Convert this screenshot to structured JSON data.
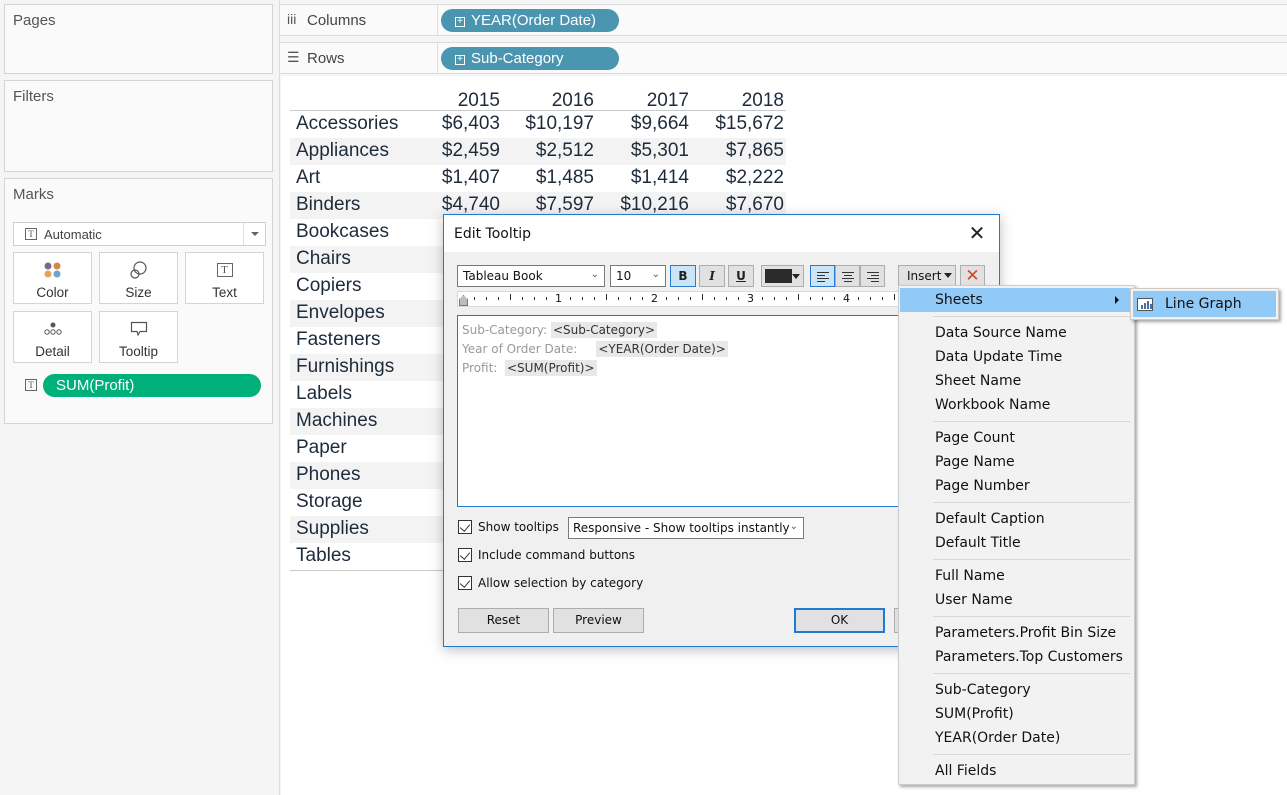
{
  "panels": {
    "pages_title": "Pages",
    "filters_title": "Filters",
    "marks_title": "Marks"
  },
  "marks": {
    "type_selected": "Automatic",
    "buttons": [
      {
        "label": "Color",
        "icon": "color-icon"
      },
      {
        "label": "Size",
        "icon": "size-icon"
      },
      {
        "label": "Text",
        "icon": "text-icon"
      },
      {
        "label": "Detail",
        "icon": "detail-icon"
      },
      {
        "label": "Tooltip",
        "icon": "tooltip-icon"
      }
    ],
    "field_pill": "SUM(Profit)",
    "field_pill_color": "#00b07a",
    "text_icon_glyph": "T"
  },
  "shelves": {
    "columns_label": "Columns",
    "columns_icon": "iii",
    "columns_pill": "YEAR(Order Date)",
    "rows_label": "Rows",
    "rows_icon": "☰",
    "rows_pill": "Sub-Category",
    "pill_color": "#4a96b0",
    "pill_plus": "+"
  },
  "table": {
    "years": [
      "2015",
      "2016",
      "2017",
      "2018"
    ],
    "rows": [
      {
        "label": "Accessories",
        "values": [
          "$6,403",
          "$10,197",
          "$9,664",
          "$15,672"
        ]
      },
      {
        "label": "Appliances",
        "values": [
          "$2,459",
          "$2,512",
          "$5,301",
          "$7,865"
        ]
      },
      {
        "label": "Art",
        "values": [
          "$1,407",
          "$1,485",
          "$1,414",
          "$2,222"
        ]
      },
      {
        "label": "Binders",
        "values": [
          "$4,740",
          "$7,597",
          "$10,216",
          "$7,670"
        ]
      },
      {
        "label": "Bookcases",
        "values": [
          "",
          "",
          "",
          ""
        ]
      },
      {
        "label": "Chairs",
        "values": [
          "",
          "",
          "",
          ""
        ]
      },
      {
        "label": "Copiers",
        "values": [
          "",
          "",
          "",
          ""
        ]
      },
      {
        "label": "Envelopes",
        "values": [
          "",
          "",
          "",
          ""
        ]
      },
      {
        "label": "Fasteners",
        "values": [
          "",
          "",
          "",
          ""
        ]
      },
      {
        "label": "Furnishings",
        "values": [
          "",
          "",
          "",
          ""
        ]
      },
      {
        "label": "Labels",
        "values": [
          "",
          "",
          "",
          ""
        ]
      },
      {
        "label": "Machines",
        "values": [
          "",
          "",
          "",
          ""
        ]
      },
      {
        "label": "Paper",
        "values": [
          "",
          "",
          "",
          ""
        ]
      },
      {
        "label": "Phones",
        "values": [
          "$",
          "",
          "",
          ""
        ]
      },
      {
        "label": "Storage",
        "values": [
          "",
          "",
          "",
          ""
        ]
      },
      {
        "label": "Supplies",
        "values": [
          "",
          "",
          "",
          ""
        ]
      },
      {
        "label": "Tables",
        "values": [
          "–",
          "",
          "",
          ""
        ]
      }
    ]
  },
  "dialog": {
    "title": "Edit Tooltip",
    "close_glyph": "✕",
    "font": "Tableau Book",
    "font_size": "10",
    "bold": "B",
    "italic": "I",
    "underline": "U",
    "insert_label": "Insert",
    "clear_glyph": "✕",
    "ruler_numbers": [
      "1",
      "2",
      "3",
      "4"
    ],
    "editor_lines": [
      {
        "label": "Sub-Category: ",
        "field": "<Sub-Category>"
      },
      {
        "label": "Year of Order Date:     ",
        "field": "<YEAR(Order Date)>"
      },
      {
        "label": "Profit:  ",
        "field": "<SUM(Profit)>"
      }
    ],
    "show_tooltips_label": "Show tooltips",
    "show_tooltips_checked": true,
    "tooltip_mode": "Responsive - Show tooltips instantly",
    "include_command_buttons_label": "Include command buttons",
    "include_command_buttons_checked": true,
    "allow_selection_label": "Allow selection by category",
    "allow_selection_checked": true,
    "reset_label": "Reset",
    "preview_label": "Preview",
    "ok_label": "OK"
  },
  "insert_menu": {
    "groups": [
      [
        "Sheets"
      ],
      [
        "Data Source Name",
        "Data Update Time",
        "Sheet Name",
        "Workbook Name"
      ],
      [
        "Page Count",
        "Page Name",
        "Page Number"
      ],
      [
        "Default Caption",
        "Default Title"
      ],
      [
        "Full Name",
        "User Name"
      ],
      [
        "Parameters.Profit Bin Size",
        "Parameters.Top Customers"
      ],
      [
        "Sub-Category",
        "SUM(Profit)",
        "YEAR(Order Date)"
      ],
      [
        "All Fields"
      ]
    ],
    "highlighted": "Sheets",
    "highlight_color": "#91c9f7"
  },
  "sheets_submenu": {
    "items": [
      "Line Graph"
    ]
  }
}
